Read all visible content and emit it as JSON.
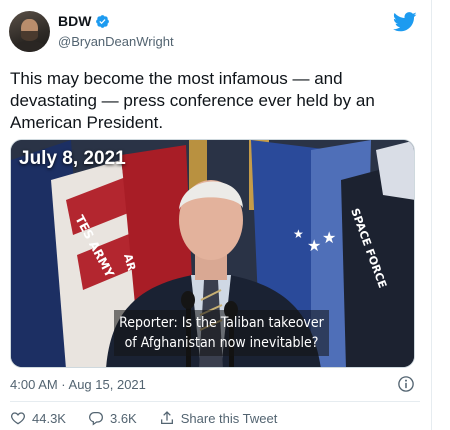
{
  "author": {
    "display_name": "BDW",
    "handle": "@BryanDeanWright",
    "verified": true
  },
  "tweet": {
    "text": "This may become the most infamous — and\ndevastating —  press conference ever held by an\nAmerican President.",
    "timestamp": "4:00 AM · Aug 15, 2021"
  },
  "media": {
    "date_overlay": "July 8, 2021",
    "caption": "Reporter: Is the Taliban takeover of Afghanistan now inevitable?",
    "flag_texts": [
      "TES ARMY",
      "SPACE FORCE",
      "AR"
    ]
  },
  "actions": {
    "likes": "44.3K",
    "replies": "3.6K",
    "share_label": "Share this Tweet"
  },
  "icons": {
    "brand": "twitter-bird-icon",
    "verified": "verified-badge-icon",
    "info": "info-icon",
    "like": "heart-icon",
    "reply": "reply-icon",
    "share": "share-icon"
  },
  "colors": {
    "brand": "#1d9bf0",
    "text": "#0f1419",
    "muted": "#536471"
  }
}
